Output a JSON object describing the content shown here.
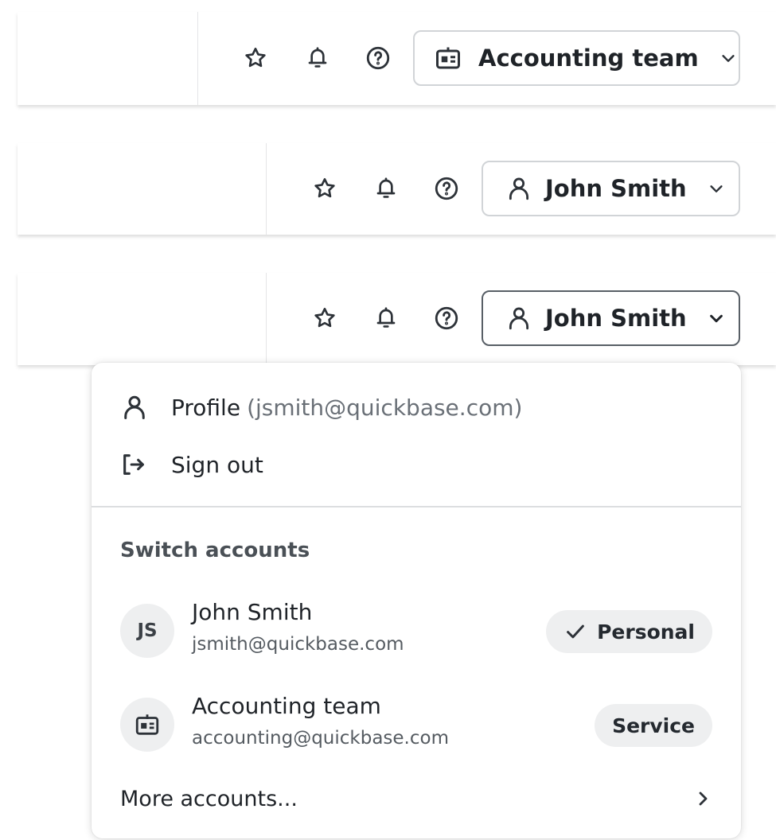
{
  "icons": {
    "star": "star-icon",
    "bell": "bell-icon",
    "help": "help-circle-icon",
    "badge": "id-badge-icon",
    "user": "user-icon",
    "chevron_down": "chevron-down-icon",
    "sign_out": "sign-out-icon",
    "check": "check-icon",
    "chevron_right": "chevron-right-icon"
  },
  "headers": [
    {
      "account_label": "Accounting team",
      "account_icon": "id-badge-icon"
    },
    {
      "account_label": "John Smith",
      "account_icon": "user-icon"
    },
    {
      "account_label": "John Smith",
      "account_icon": "user-icon",
      "open": true
    }
  ],
  "menu": {
    "profile_label": "Profile",
    "profile_email": "(jsmith@quickbase.com)",
    "sign_out_label": "Sign out",
    "switch_title": "Switch accounts",
    "accounts": [
      {
        "initials": "JS",
        "name": "John Smith",
        "email": "jsmith@quickbase.com",
        "badge": "Personal",
        "selected": true
      },
      {
        "name": "Accounting team",
        "email": "accounting@quickbase.com",
        "badge": "Service",
        "selected": false
      }
    ],
    "more_label": "More accounts..."
  },
  "colors": {
    "text": "#1f2328",
    "muted_text": "#6a7077",
    "border": "#d1d4d7",
    "active_border": "#585f66",
    "badge_bg": "#eeeff0"
  }
}
